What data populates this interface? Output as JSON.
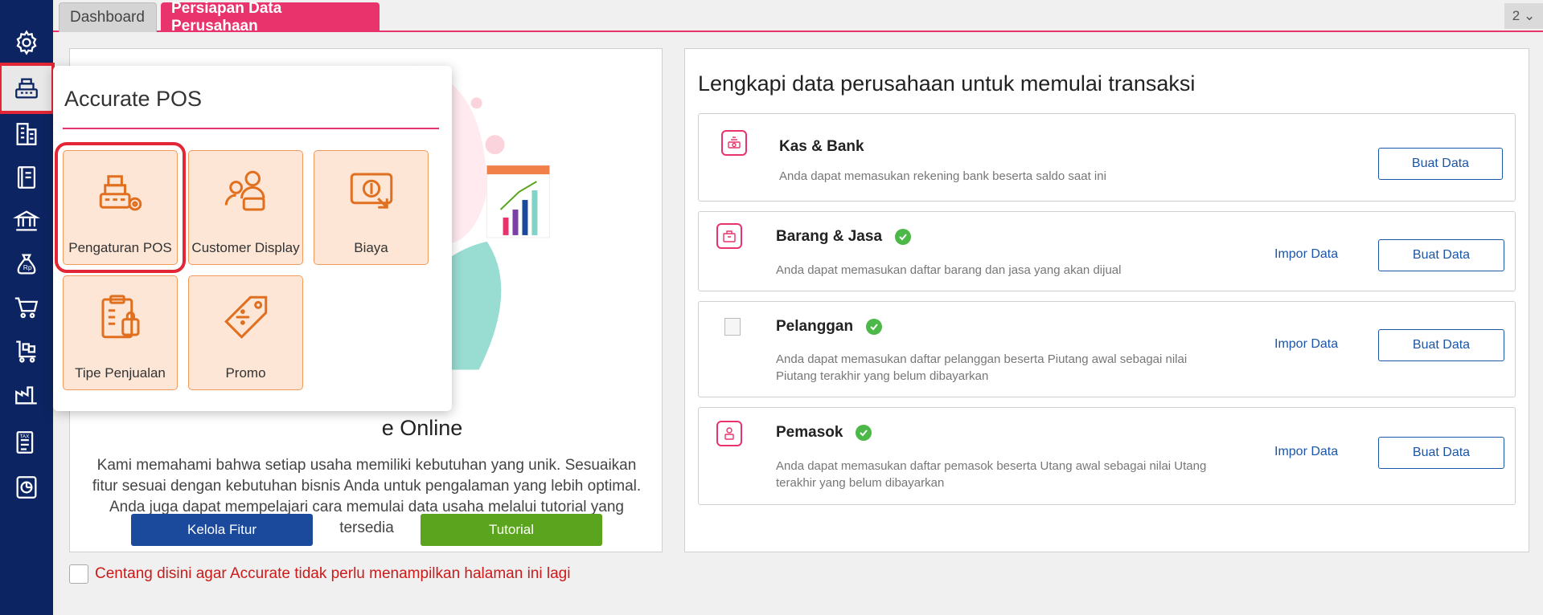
{
  "tabs": {
    "dashboard": "Dashboard",
    "setup": "Persiapan Data Perusahaan",
    "counter": "2 ⌄"
  },
  "left": {
    "heading": "e Online",
    "description": "Kami memahami bahwa setiap usaha memiliki kebutuhan yang unik. Sesuaikan fitur sesuai dengan kebutuhan bisnis Anda untuk pengalaman yang lebih optimal. Anda juga dapat mempelajari cara memulai data usaha melalui tutorial yang tersedia",
    "btn_kelola": "Kelola Fitur",
    "btn_tutorial": "Tutorial",
    "checkbox_label": "Centang disini agar Accurate tidak perlu menampilkan halaman ini lagi"
  },
  "popup": {
    "title": "Accurate POS",
    "tiles": [
      {
        "label": "Pengaturan POS",
        "icon": "pos-settings-icon"
      },
      {
        "label": "Customer Display",
        "icon": "customer-display-icon"
      },
      {
        "label": "Biaya",
        "icon": "cost-icon"
      },
      {
        "label": "Tipe Penjualan",
        "icon": "sales-type-icon"
      },
      {
        "label": "Promo",
        "icon": "promo-tag-icon"
      }
    ]
  },
  "right": {
    "title": "Lengkapi data perusahaan untuk memulai transaksi",
    "items": [
      {
        "title": "Kas & Bank",
        "desc": "Anda dapat memasukan rekening bank beserta saldo saat ini",
        "buat": "Buat Data"
      },
      {
        "title": "Barang & Jasa",
        "desc": "Anda dapat memasukan daftar barang dan jasa yang akan dijual",
        "impor": "Impor Data",
        "buat": "Buat Data"
      },
      {
        "title": "Pelanggan",
        "desc": "Anda dapat memasukan daftar pelanggan beserta Piutang awal sebagai nilai Piutang terakhir yang belum dibayarkan",
        "impor": "Impor Data",
        "buat": "Buat Data"
      },
      {
        "title": "Pemasok",
        "desc": "Anda dapat memasukan daftar pemasok beserta Utang awal sebagai nilai Utang terakhir yang belum dibayarkan",
        "impor": "Impor Data",
        "buat": "Buat Data"
      }
    ]
  },
  "colors": {
    "sidebar": "#0c2461",
    "accent": "#e8336c",
    "kelola": "#1b4a9c",
    "tutorial": "#5aa51d",
    "check": "#4cb848"
  }
}
